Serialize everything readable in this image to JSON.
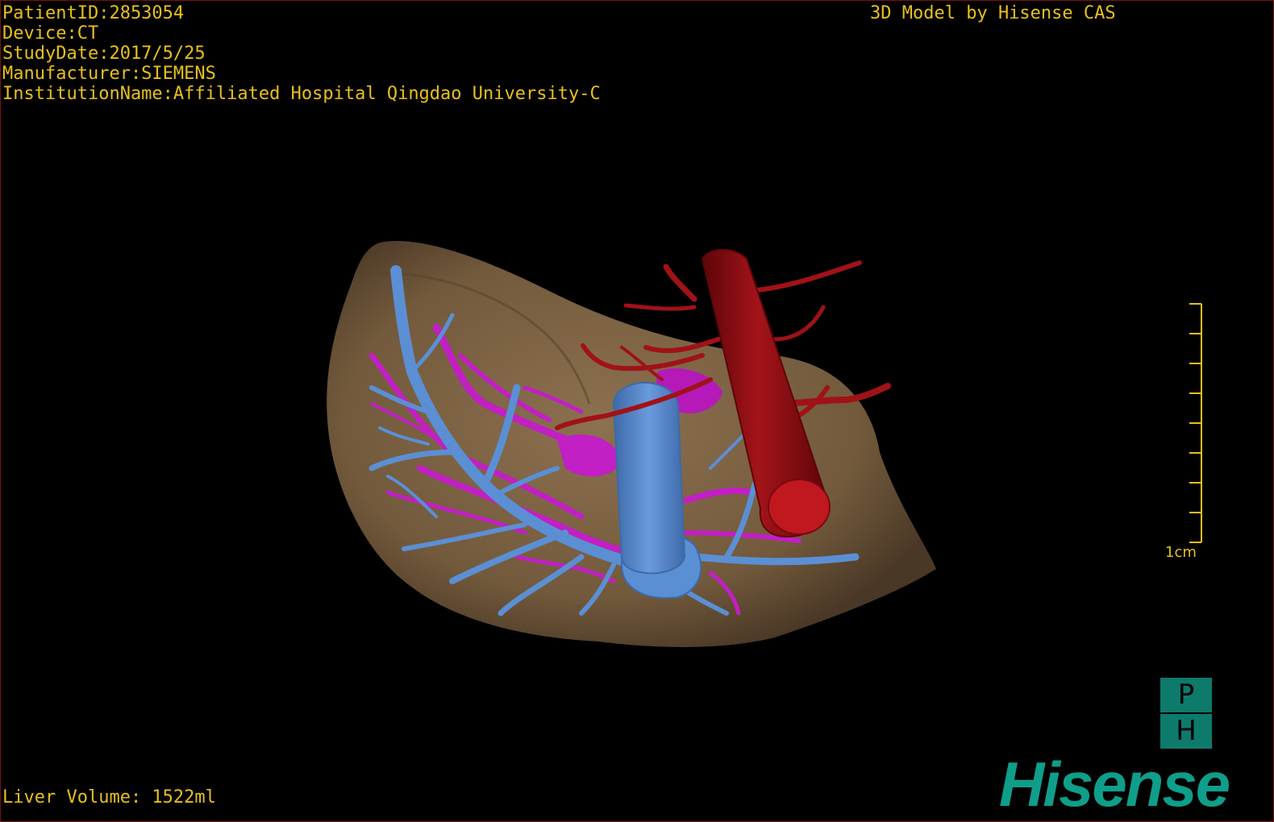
{
  "patient_info": {
    "patient_id": "PatientID:2853054",
    "device": "Device:CT",
    "study_date": "StudyDate:2017/5/25",
    "manufacturer": "Manufacturer:SIEMENS",
    "institution": "InstitutionName:Affiliated Hospital Qingdao University-C"
  },
  "brand_caption": "3D Model by Hisense CAS",
  "liver_volume": "Liver Volume: 1522ml",
  "scale": {
    "label": "1cm"
  },
  "badge": {
    "top": "P",
    "bottom": "H"
  },
  "logo": "Hisense",
  "colors": {
    "overlay_text": "#e8c01a",
    "liver": "#7d6446",
    "portal_vein": "#5b8fd4",
    "hepatic_vein": "#c21fc4",
    "artery": "#9b0f14",
    "logo": "#0f9e8a"
  }
}
